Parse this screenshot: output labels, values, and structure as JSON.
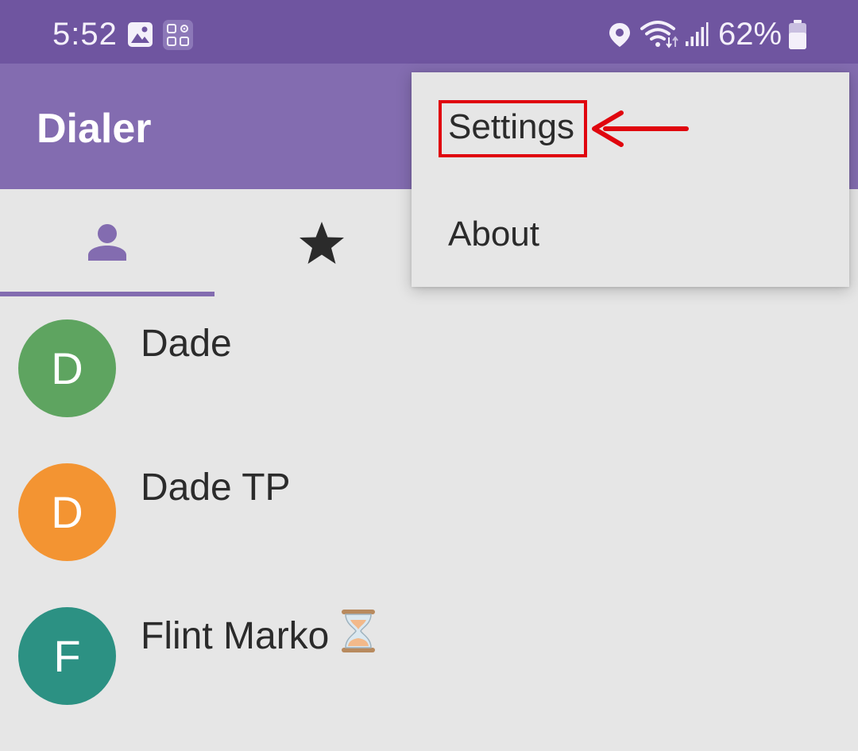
{
  "status_bar": {
    "time": "5:52",
    "battery_text": "62%",
    "icons": [
      "gallery-icon",
      "apps-icon",
      "location-icon",
      "wifi-icon",
      "signal-icon",
      "battery-icon"
    ]
  },
  "app_bar": {
    "title": "Dialer"
  },
  "tabs": [
    {
      "name": "contacts",
      "icon": "person-icon",
      "selected": true
    },
    {
      "name": "favorites",
      "icon": "star-icon",
      "selected": false
    }
  ],
  "contacts": [
    {
      "initial": "D",
      "name": "Dade",
      "avatar_color": "#5ea460"
    },
    {
      "initial": "D",
      "name": "Dade TP",
      "avatar_color": "#f39432"
    },
    {
      "initial": "F",
      "name": "Flint Marko",
      "avatar_color": "#2c9183",
      "badge_icon": "hourglass-icon"
    }
  ],
  "menu": {
    "items": [
      {
        "label": "Settings",
        "highlighted": true
      },
      {
        "label": "About",
        "highlighted": false
      }
    ]
  },
  "colors": {
    "status_bar": "#6f55a0",
    "app_bar": "#836cb0",
    "accent": "#836cb0",
    "background": "#e6e6e6",
    "annotation": "#e0060e"
  }
}
